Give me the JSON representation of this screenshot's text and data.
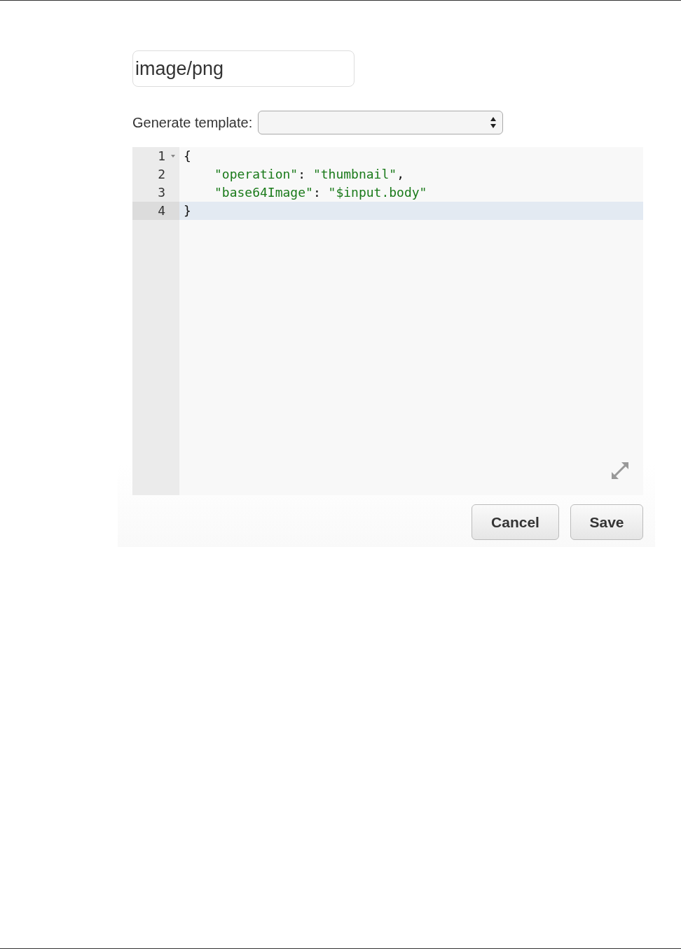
{
  "content_type_field": {
    "value": "image/png"
  },
  "template_select": {
    "label": "Generate template:"
  },
  "editor": {
    "lines": [
      {
        "number": "1",
        "foldable": true,
        "active": false,
        "indented": false,
        "tokens": [
          {
            "kind": "punct",
            "text": "{"
          }
        ]
      },
      {
        "number": "2",
        "foldable": false,
        "active": false,
        "indented": true,
        "tokens": [
          {
            "kind": "string",
            "text": "\"operation\""
          },
          {
            "kind": "punct",
            "text": ": "
          },
          {
            "kind": "string",
            "text": "\"thumbnail\""
          },
          {
            "kind": "punct",
            "text": ","
          }
        ]
      },
      {
        "number": "3",
        "foldable": false,
        "active": false,
        "indented": true,
        "tokens": [
          {
            "kind": "string",
            "text": "\"base64Image\""
          },
          {
            "kind": "punct",
            "text": ": "
          },
          {
            "kind": "string",
            "text": "\"$input.body\""
          }
        ]
      },
      {
        "number": "4",
        "foldable": false,
        "active": true,
        "indented": false,
        "tokens": [
          {
            "kind": "punct",
            "text": "}"
          }
        ]
      }
    ]
  },
  "buttons": [
    {
      "label": "Cancel"
    },
    {
      "label": "Save"
    }
  ]
}
